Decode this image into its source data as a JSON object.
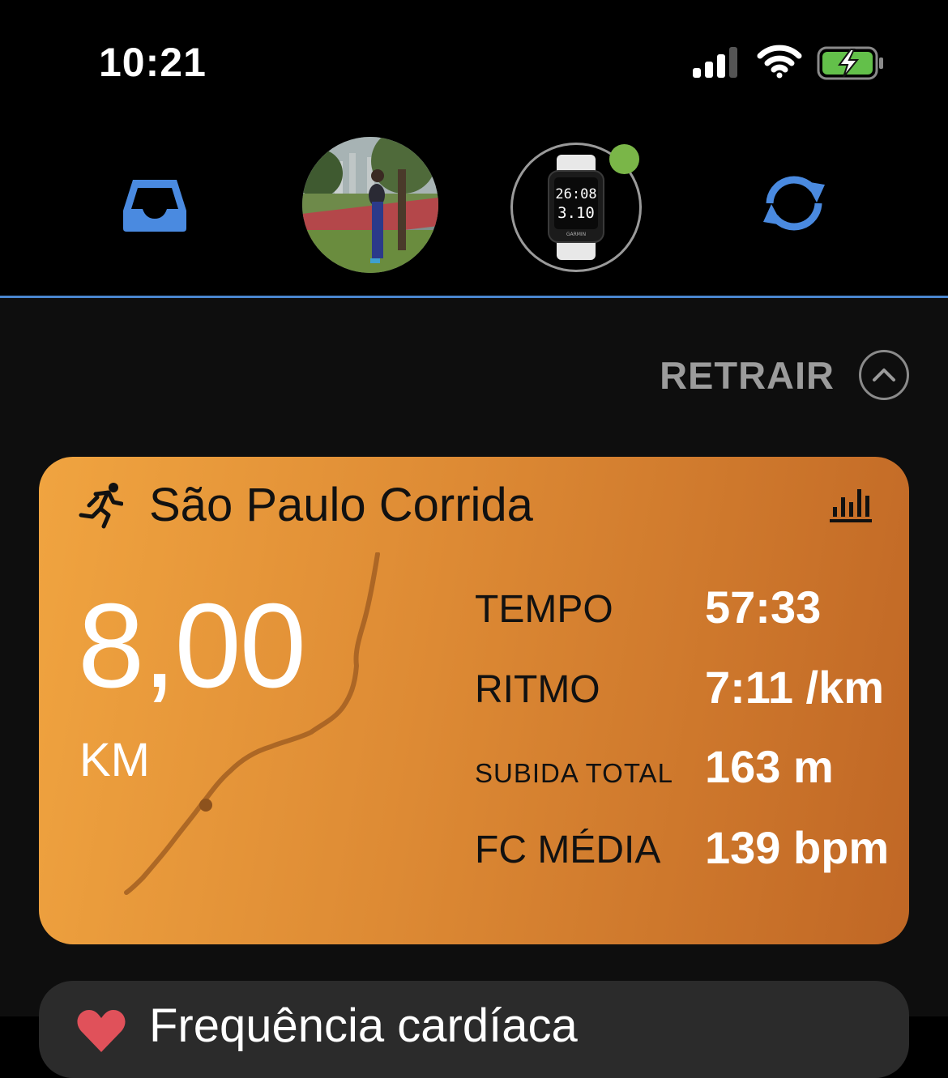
{
  "status_bar": {
    "time": "10:21",
    "icons": [
      "signal-icon",
      "wifi-icon",
      "battery-charging-icon"
    ]
  },
  "top_nav": {
    "inbox_icon": "inbox-icon",
    "profile_avatar": "avatar-photo",
    "device": {
      "screen_line1": "26:08",
      "screen_line2": "3.10",
      "brand": "GARMIN",
      "connected": true,
      "connected_color": "#7ab648"
    },
    "sync_icon": "sync-icon",
    "accent_color": "#4a86cf"
  },
  "main": {
    "collapse_label": "RETRAIR",
    "activity_card": {
      "type_icon": "running-icon",
      "title": "São Paulo Corrida",
      "stats_icon": "bar-chart-icon",
      "distance": "8,00",
      "distance_unit": "KM",
      "metrics": [
        {
          "label": "TEMPO",
          "value": "57:33"
        },
        {
          "label": "RITMO",
          "value": "7:11 /km"
        },
        {
          "label": "SUBIDA TOTAL",
          "value": "163 m"
        },
        {
          "label": "FC MÉDIA",
          "value": "139 bpm"
        }
      ],
      "gradient_colors": [
        "#f0a440",
        "#c06725"
      ]
    },
    "next_card": {
      "icon": "heart-icon",
      "title": "Frequência cardíaca"
    }
  }
}
